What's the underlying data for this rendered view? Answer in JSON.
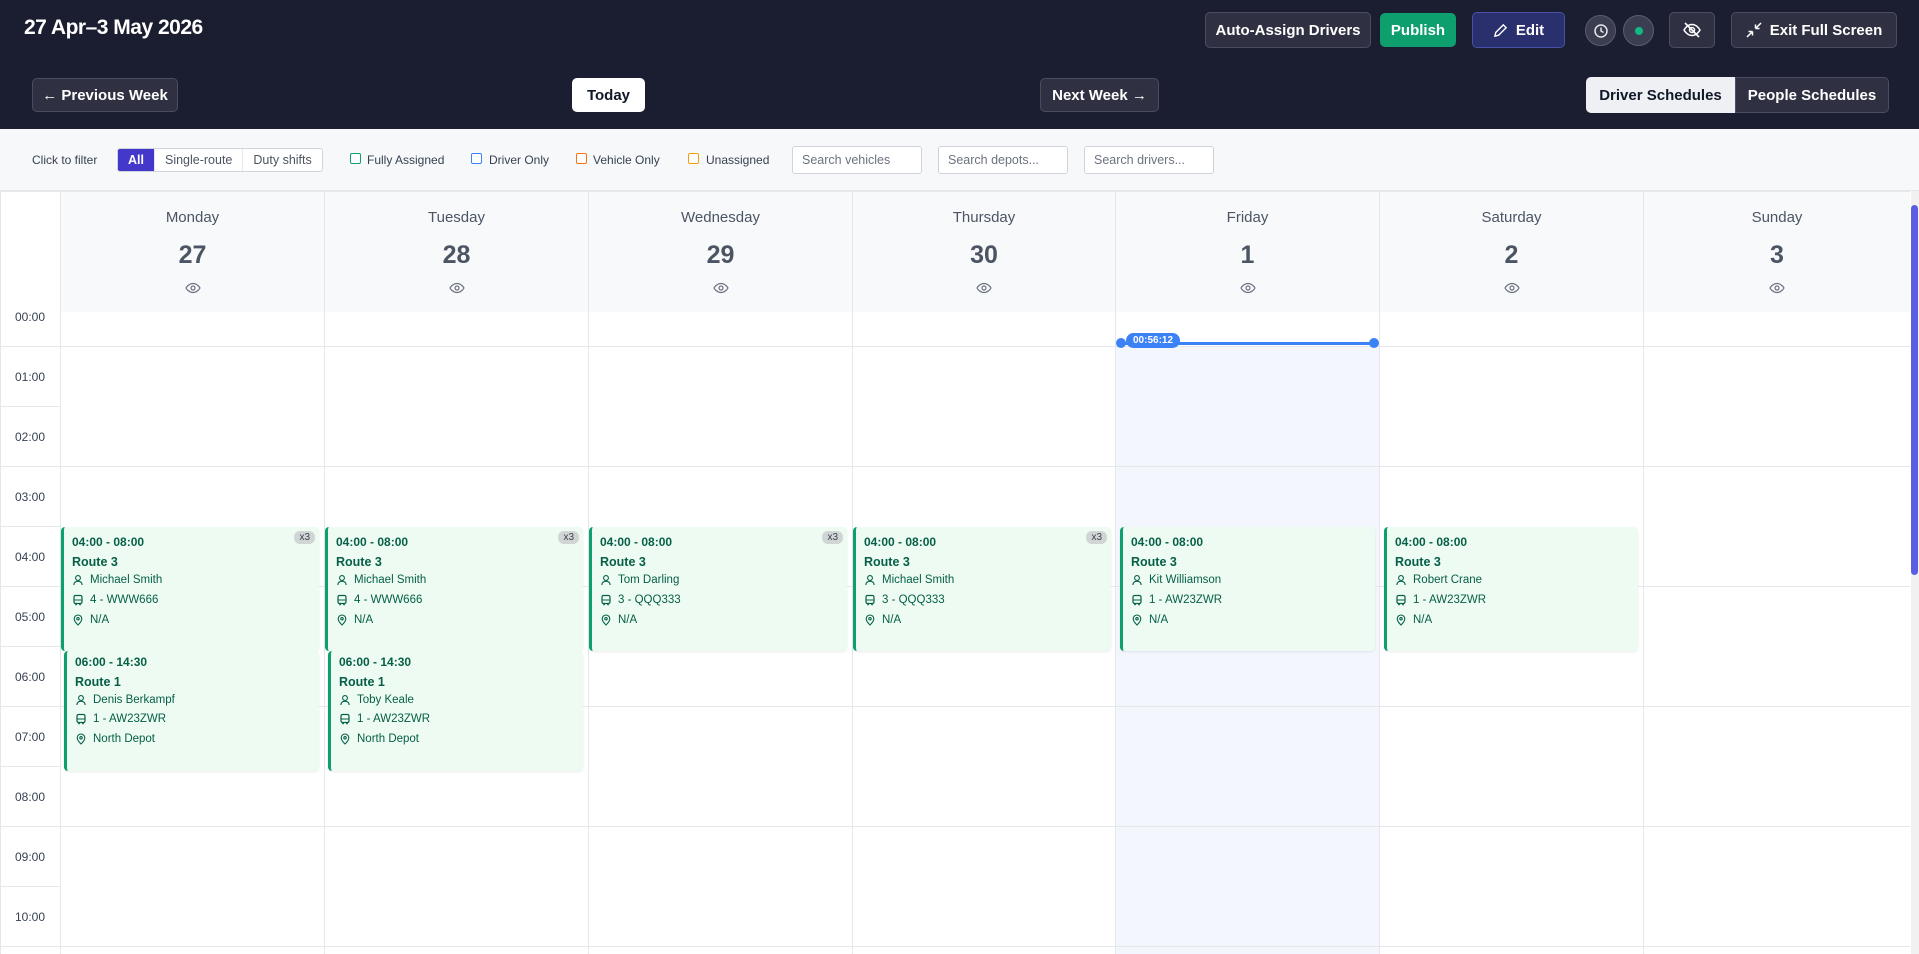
{
  "header": {
    "title": "27 Apr–3 May 2026",
    "auto_assign": "Auto-Assign Drivers",
    "publish": "Publish",
    "edit": "Edit",
    "exit_full_screen": "Exit Full Screen",
    "prev_week": "← Previous Week",
    "today": "Today",
    "next_week": "Next Week →",
    "driver_schedules": "Driver Schedules",
    "people_schedules": "People Schedules"
  },
  "filters": {
    "click_to_filter": "Click to filter",
    "segments": [
      "All",
      "Single-route",
      "Duty shifts"
    ],
    "fully_assigned": "Fully Assigned",
    "driver_only": "Driver Only",
    "vehicle_only": "Vehicle Only",
    "unassigned": "Unassigned",
    "search_vehicles": "Search vehicles",
    "search_depots": "Search depots...",
    "search_drivers": "Search drivers...",
    "colors": {
      "fully_assigned": "#0e9f6e",
      "driver_only": "#3b82f6",
      "vehicle_only": "#f97316",
      "unassigned": "#f59e0b"
    }
  },
  "days": [
    {
      "name": "Monday",
      "num": "27"
    },
    {
      "name": "Tuesday",
      "num": "28"
    },
    {
      "name": "Wednesday",
      "num": "29"
    },
    {
      "name": "Thursday",
      "num": "30"
    },
    {
      "name": "Friday",
      "num": "1"
    },
    {
      "name": "Saturday",
      "num": "2"
    },
    {
      "name": "Sunday",
      "num": "3"
    }
  ],
  "hours": [
    "00:00",
    "01:00",
    "02:00",
    "03:00",
    "04:00",
    "05:00",
    "06:00",
    "07:00",
    "08:00",
    "09:00",
    "10:00"
  ],
  "current_time": "00:56:12",
  "events": {
    "mon_a": {
      "time": "04:00 - 08:00",
      "route": "Route 3",
      "driver": "Michael Smith",
      "vehicle": "4 - WWW666",
      "depot": "N/A",
      "badge": "x3"
    },
    "mon_b": {
      "time": "06:00 - 14:30",
      "route": "Route 1",
      "driver": "Denis Berkampf",
      "vehicle": "1 - AW23ZWR",
      "depot": "North Depot"
    },
    "tue_a": {
      "time": "04:00 - 08:00",
      "route": "Route 3",
      "driver": "Michael Smith",
      "vehicle": "4 - WWW666",
      "depot": "N/A",
      "badge": "x3"
    },
    "tue_b": {
      "time": "06:00 - 14:30",
      "route": "Route 1",
      "driver": "Toby Keale",
      "vehicle": "1 - AW23ZWR",
      "depot": "North Depot"
    },
    "wed_a": {
      "time": "04:00 - 08:00",
      "route": "Route 3",
      "driver": "Tom Darling",
      "vehicle": "3 - QQQ333",
      "depot": "N/A",
      "badge": "x3"
    },
    "thu_a": {
      "time": "04:00 - 08:00",
      "route": "Route 3",
      "driver": "Michael Smith",
      "vehicle": "3 - QQQ333",
      "depot": "N/A",
      "badge": "x3"
    },
    "fri_a": {
      "time": "04:00 - 08:00",
      "route": "Route 3",
      "driver": "Kit Williamson",
      "vehicle": "1 - AW23ZWR",
      "depot": "N/A"
    },
    "sat_a": {
      "time": "04:00 - 08:00",
      "route": "Route 3",
      "driver": "Robert Crane",
      "vehicle": "1 - AW23ZWR",
      "depot": "N/A"
    }
  }
}
